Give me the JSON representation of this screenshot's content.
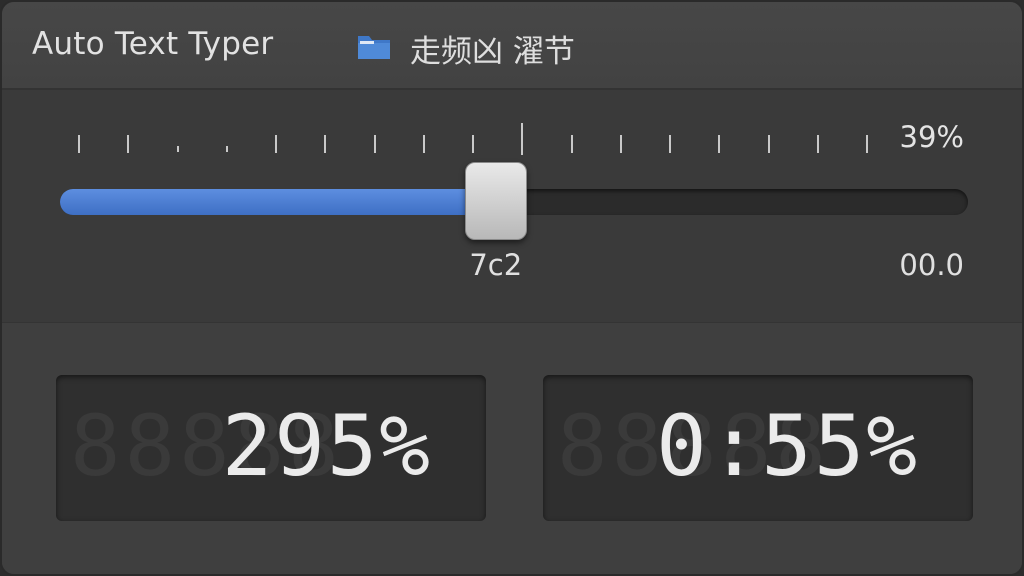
{
  "window": {
    "title": "Auto Text Typer",
    "folder_label": "走频凶 濯节",
    "folder_icon": "folder-icon",
    "accent_color": "#3e6fc4"
  },
  "slider": {
    "top_percent_label": "39%",
    "value_percent": 48,
    "thumb_label": "7c2",
    "right_label": "00.0",
    "tick_count": 17
  },
  "displays": [
    {
      "value": "295%",
      "ghost": "88888"
    },
    {
      "value": "0:55%",
      "ghost": "88888"
    }
  ]
}
